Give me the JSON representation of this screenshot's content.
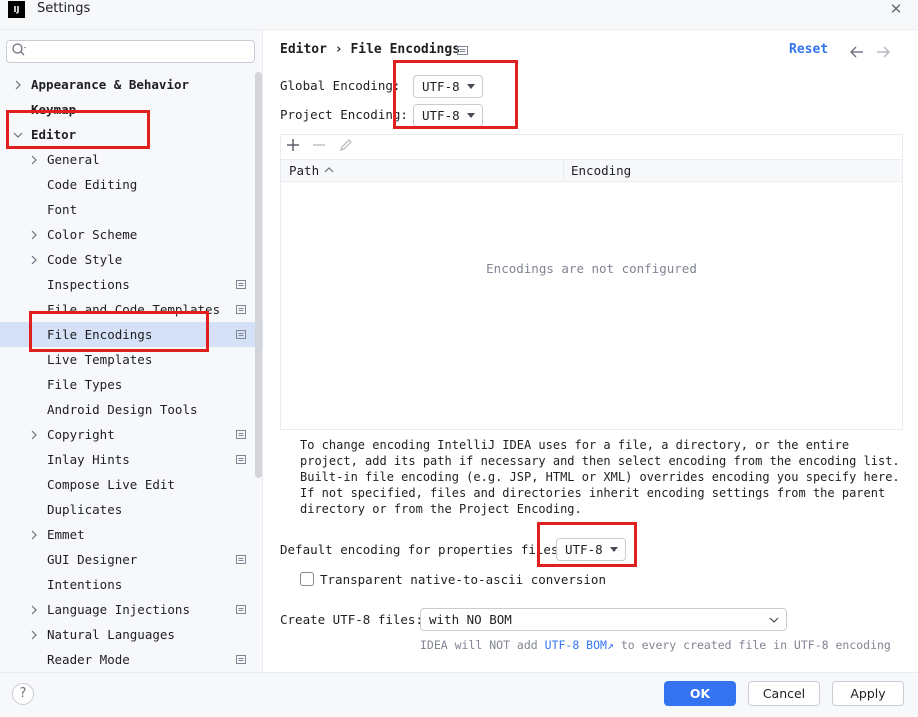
{
  "window": {
    "title": "Settings",
    "app_icon": "IJ",
    "close_icon": "close-icon"
  },
  "sidebar": {
    "search": {
      "value": "",
      "placeholder": "",
      "icon": "search-icon"
    },
    "items": [
      {
        "label": "Appearance & Behavior",
        "level": 0,
        "expanded": false,
        "has_chevron": true,
        "bold": true,
        "badge": false
      },
      {
        "label": "Keymap",
        "level": 0,
        "has_chevron": false,
        "bold": true,
        "badge": false
      },
      {
        "label": "Editor",
        "level": 0,
        "expanded": true,
        "has_chevron": true,
        "bold": true,
        "badge": false
      },
      {
        "label": "General",
        "level": 1,
        "has_chevron": true,
        "badge": false
      },
      {
        "label": "Code Editing",
        "level": 1,
        "has_chevron": false,
        "badge": false
      },
      {
        "label": "Font",
        "level": 1,
        "has_chevron": false,
        "badge": false
      },
      {
        "label": "Color Scheme",
        "level": 1,
        "has_chevron": true,
        "badge": false
      },
      {
        "label": "Code Style",
        "level": 1,
        "has_chevron": true,
        "badge": false
      },
      {
        "label": "Inspections",
        "level": 1,
        "has_chevron": false,
        "badge": true
      },
      {
        "label": "File and Code Templates",
        "level": 1,
        "has_chevron": false,
        "badge": true
      },
      {
        "label": "File Encodings",
        "level": 1,
        "has_chevron": false,
        "badge": true,
        "selected": true
      },
      {
        "label": "Live Templates",
        "level": 1,
        "has_chevron": false,
        "badge": false
      },
      {
        "label": "File Types",
        "level": 1,
        "has_chevron": false,
        "badge": false
      },
      {
        "label": "Android Design Tools",
        "level": 1,
        "has_chevron": false,
        "badge": false
      },
      {
        "label": "Copyright",
        "level": 1,
        "has_chevron": true,
        "badge": true
      },
      {
        "label": "Inlay Hints",
        "level": 1,
        "has_chevron": false,
        "badge": true
      },
      {
        "label": "Compose Live Edit",
        "level": 1,
        "has_chevron": false,
        "badge": false
      },
      {
        "label": "Duplicates",
        "level": 1,
        "has_chevron": false,
        "badge": false
      },
      {
        "label": "Emmet",
        "level": 1,
        "has_chevron": true,
        "badge": false
      },
      {
        "label": "GUI Designer",
        "level": 1,
        "has_chevron": false,
        "badge": true
      },
      {
        "label": "Intentions",
        "level": 1,
        "has_chevron": false,
        "badge": false
      },
      {
        "label": "Language Injections",
        "level": 1,
        "has_chevron": true,
        "badge": true
      },
      {
        "label": "Natural Languages",
        "level": 1,
        "has_chevron": true,
        "badge": false
      },
      {
        "label": "Reader Mode",
        "level": 1,
        "has_chevron": false,
        "badge": true
      }
    ]
  },
  "header": {
    "breadcrumb_parent": "Editor",
    "breadcrumb_sep": "›",
    "breadcrumb_current": "File Encodings",
    "reset_label": "Reset",
    "back_icon": "arrow-left-icon",
    "forward_icon": "arrow-right-icon"
  },
  "encoding": {
    "global_label": "Global Encoding:",
    "global_value": "UTF-8",
    "project_label": "Project Encoding:",
    "project_value": "UTF-8"
  },
  "table": {
    "toolbar": [
      "add-icon",
      "remove-icon",
      "edit-icon"
    ],
    "columns": [
      "Path",
      "Encoding"
    ],
    "sort_icon": "sort-ascending-icon",
    "empty_text": "Encodings are not configured",
    "rows": []
  },
  "help_text": "To change encoding IntelliJ IDEA uses for a file, a directory, or the entire project, add its path if necessary and then select encoding from the encoding list. Built-in file encoding (e.g. JSP, HTML or XML) overrides encoding you specify here. If not specified, files and directories inherit encoding settings from the parent directory or from the Project Encoding.",
  "properties": {
    "label": "Default encoding for properties files:",
    "value": "UTF-8",
    "transparent_label": "Transparent native-to-ascii conversion",
    "transparent_checked": false
  },
  "bom": {
    "label": "Create UTF-8 files:",
    "value": "with NO BOM",
    "hint_prefix": "IDEA will NOT add",
    "hint_link": "UTF-8 BOM↗",
    "hint_suffix": "to every created file in UTF-8 encoding"
  },
  "footer": {
    "help_label": "?",
    "ok_label": "OK",
    "cancel_label": "Cancel",
    "apply_label": "Apply"
  },
  "colors": {
    "accent": "#3574f0",
    "selection": "#d5e1f6",
    "annotation": "#e0201f"
  }
}
